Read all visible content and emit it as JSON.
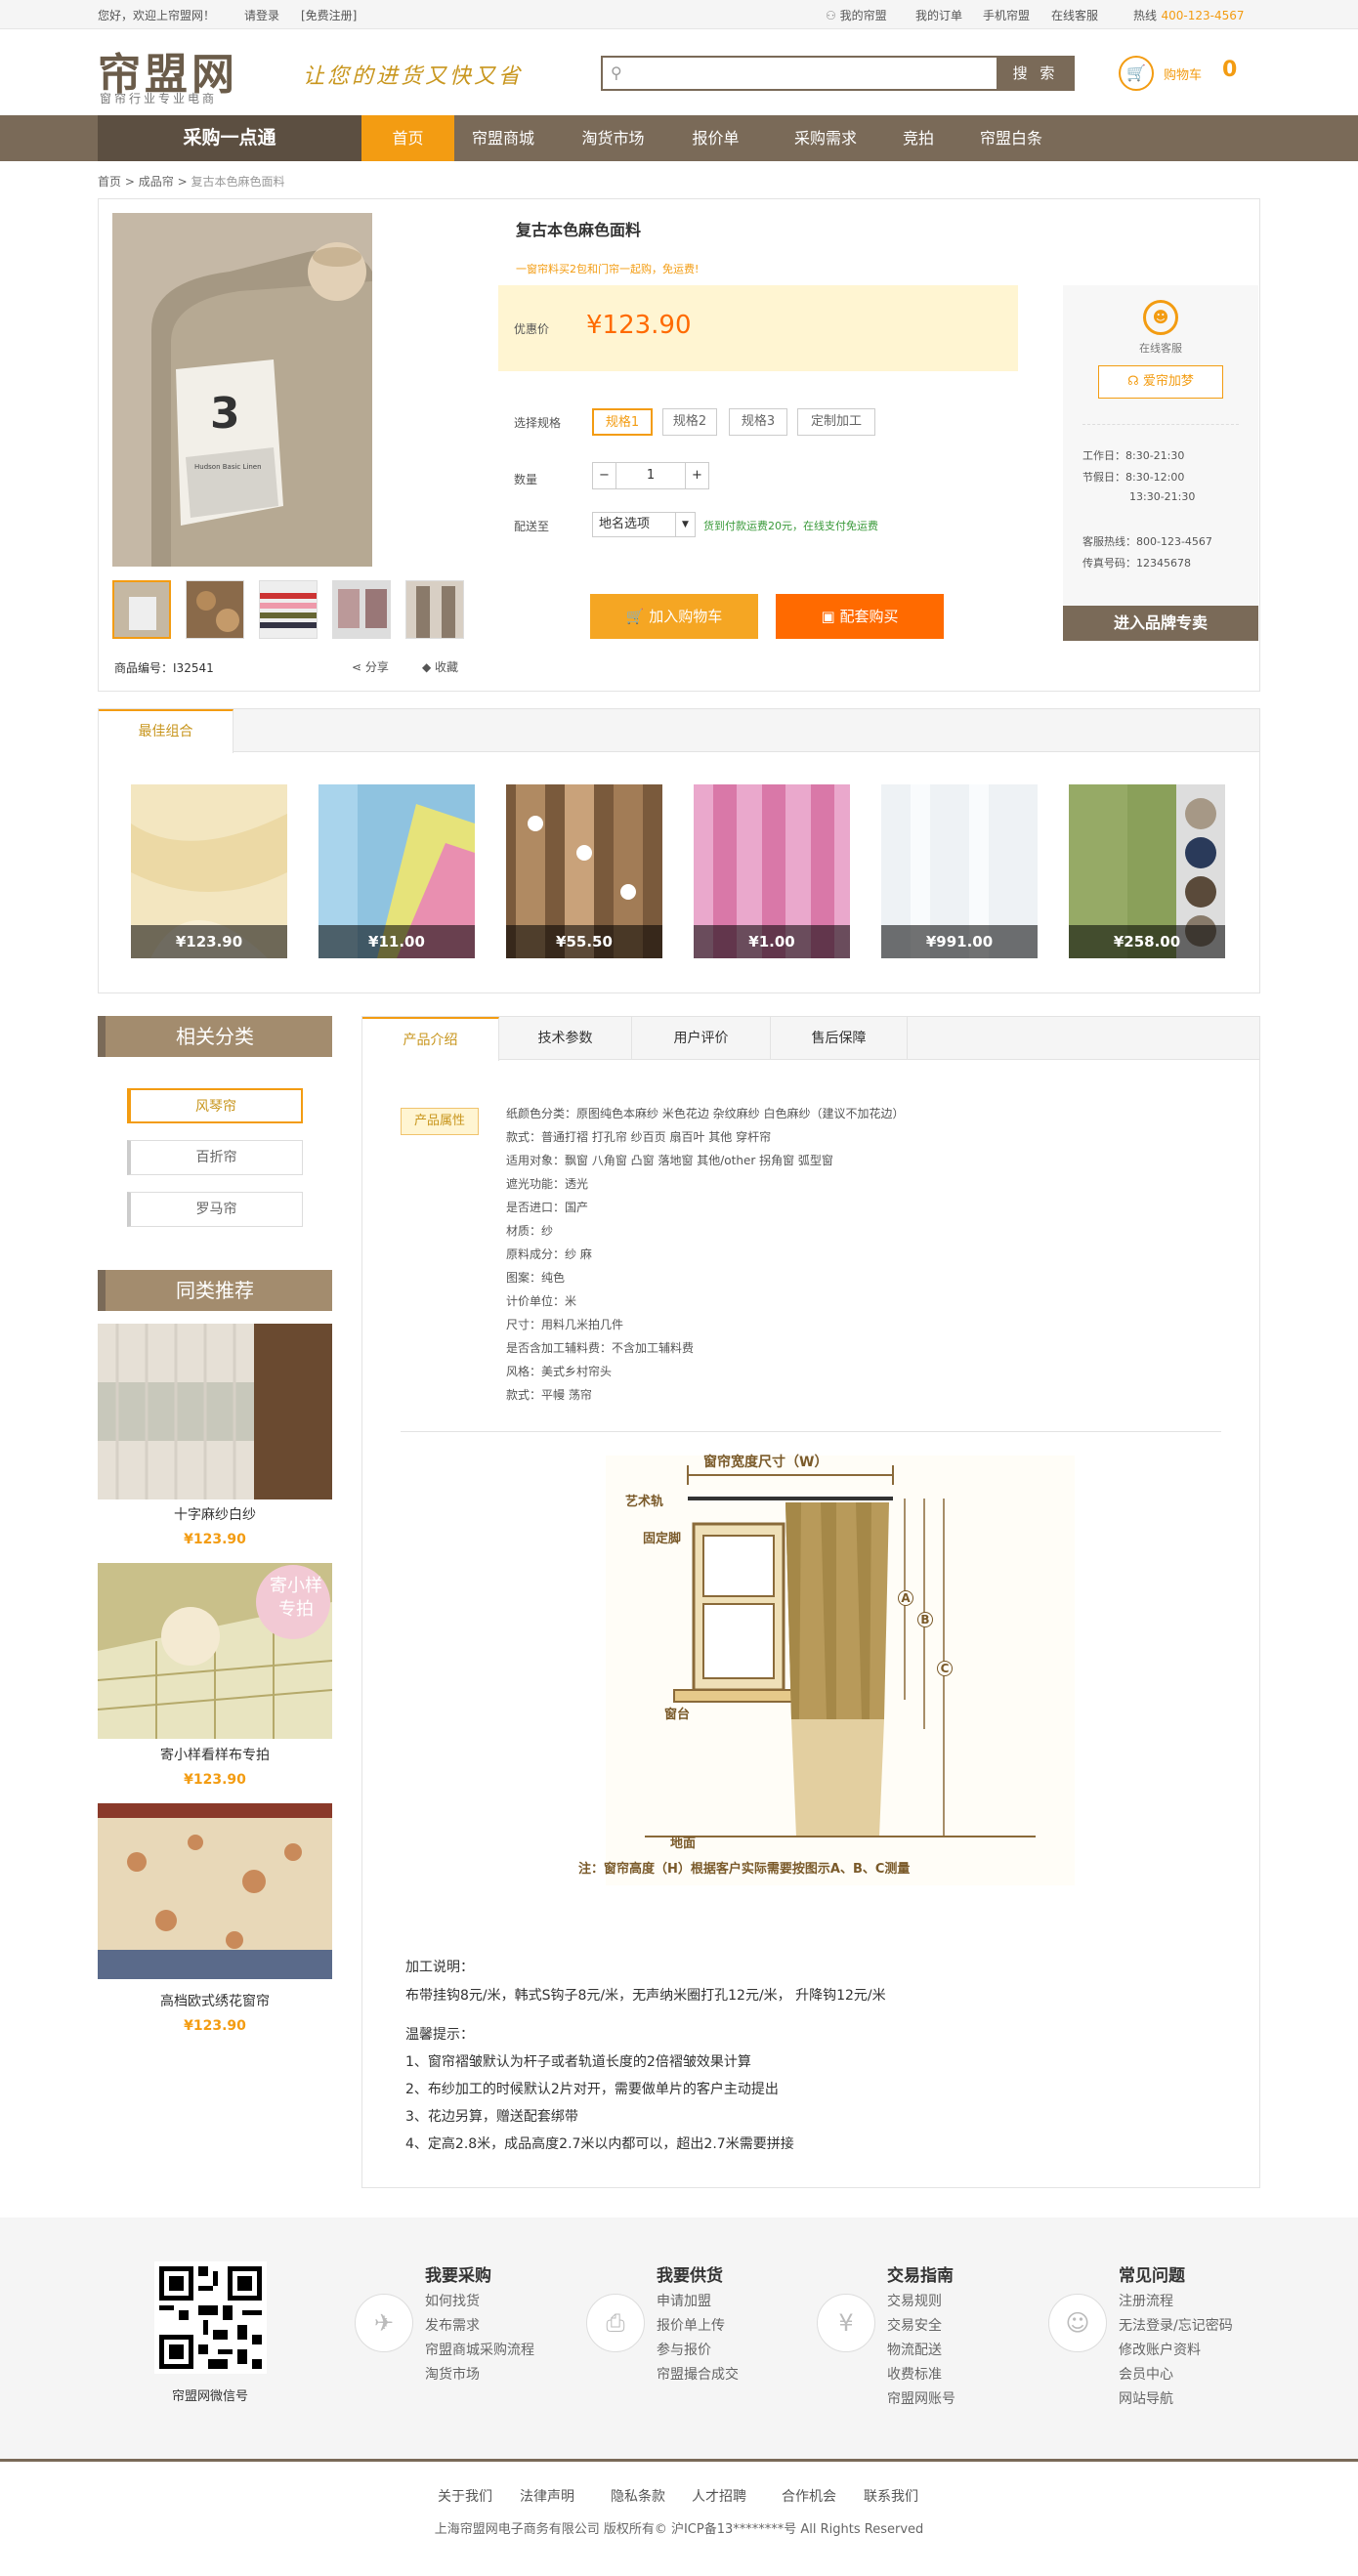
{
  "topbar": {
    "welcome": "您好，欢迎上帘盟网！",
    "login": "请登录",
    "register": "[免费注册]",
    "my_account": "我的帘盟",
    "my_orders": "我的订单",
    "mobile": "手机帘盟",
    "online_service": "在线客服",
    "hotline_label": "热线",
    "hotline": "400-123-4567"
  },
  "header": {
    "logo": "帘盟网",
    "logo_sub": "窗帘行业专业电商",
    "slogan": "让您的进货又快又省",
    "search_placeholder": "",
    "search_btn": "搜 索",
    "cart_label": "购物车",
    "cart_count": "0"
  },
  "nav": {
    "category": "采购一点通",
    "items": [
      "首页",
      "帘盟商城",
      "淘货市场",
      "报价单",
      "采购需求",
      "竞拍",
      "帘盟白条"
    ]
  },
  "breadcrumb": {
    "home": "首页",
    "sep": ">",
    "cat": "成品帘",
    "current": "复古本色麻色面料"
  },
  "product": {
    "title": "复古本色麻色面料",
    "promo": "一窗帘料买2包和门帘一起购，免运费!",
    "price_label": "优惠价",
    "price": "¥123.90",
    "spec_label": "选择规格",
    "specs": [
      "规格1",
      "规格2",
      "规格3",
      "定制加工"
    ],
    "qty_label": "数量",
    "qty": "1",
    "qty_minus": "−",
    "qty_plus": "+",
    "ship_label": "配送至",
    "ship_select": "地名选项",
    "ship_note": "货到付款运费20元，在线支付免运费",
    "add_cart": "加入购物车",
    "bundle_buy": "配套购买",
    "sku_label": "商品编号：",
    "sku": "I32541",
    "share": "分享",
    "favorite": "收藏",
    "image_label": "3",
    "image_tag": "Hudson Basic Linen"
  },
  "service": {
    "online": "在线客服",
    "brand": "爱帘加梦",
    "workday": "工作日：8:30-21:30",
    "holiday1": "节假日：8:30-12:00",
    "holiday2": "13:30-21:30",
    "hotline": "客服热线：800-123-4567",
    "fax": "传真号码：12345678",
    "brand_btn": "进入品牌专卖"
  },
  "combo": {
    "title": "最佳组合",
    "prices": [
      "¥123.90",
      "¥11.00",
      "¥55.50",
      "¥1.00",
      "¥991.00",
      "¥258.00"
    ]
  },
  "sidebar": {
    "cat_title": "相关分类",
    "cats": [
      "风琴帘",
      "百折帘",
      "罗马帘"
    ],
    "rec_title": "同类推荐",
    "recs": [
      {
        "name": "十字麻纱白纱",
        "price": "¥123.90"
      },
      {
        "name": "寄小样看样布专拍",
        "price": "¥123.90"
      },
      {
        "name": "高档欧式绣花窗帘",
        "price": "¥123.90"
      }
    ],
    "sample_badge_1": "寄小样",
    "sample_badge_2": "专拍"
  },
  "detail": {
    "tabs": [
      "产品介绍",
      "技术参数",
      "用户评价",
      "售后保障"
    ],
    "attr_tag": "产品属性",
    "attrs": [
      "纸颜色分类：原图纯色本麻纱 米色花边 杂纹麻纱 白色麻纱（建议不加花边）",
      "款式：普通打褶 打孔帘 纱百页 扇百叶 其他 穿杆帘",
      "适用对象：飘窗 八角窗 凸窗 落地窗 其他/other 拐角窗 弧型窗",
      "遮光功能：透光",
      "是否进口：国产",
      "材质：纱",
      "原料成分：纱 麻",
      "图案：纯色",
      "计价单位：米",
      "尺寸：用料几米拍几件",
      "是否含加工辅料费：不含加工辅料费",
      "风格：美式乡村帘头",
      "款式：平幔 荡帘"
    ],
    "diagram": {
      "width_label": "窗帘宽度尺寸（W）",
      "rod": "艺术轨",
      "bracket": "固定脚",
      "sill": "窗台",
      "floor": "地面",
      "a": "A",
      "b": "B",
      "c": "C",
      "note": "注：窗帘高度（H）根据客户实际需要按图示A、B、C测量"
    },
    "processing_title": "加工说明：",
    "processing_text": "布带挂钩8元/米，韩式S钩子8元/米，无声纳米圈打孔12元/米， 升降钩12元/米",
    "tips_title": "温馨提示：",
    "tips": [
      "1、窗帘褶皱默认为杆子或者轨道长度的2倍褶皱效果计算",
      "2、布纱加工的时候默认2片对开，需要做单片的客户主动提出",
      "3、花边另算，赠送配套绑带",
      "4、定高2.8米，成品高度2.7米以内都可以，超出2.7米需要拼接"
    ]
  },
  "footer": {
    "qr_label": "帘盟网微信号",
    "cols": [
      {
        "title": "我要采购",
        "links": [
          "如何找货",
          "发布需求",
          "帘盟商城采购流程",
          "淘货市场"
        ]
      },
      {
        "title": "我要供货",
        "links": [
          "申请加盟",
          "报价单上传",
          "参与报价",
          "帘盟撮合成交"
        ]
      },
      {
        "title": "交易指南",
        "links": [
          "交易规则",
          "交易安全",
          "物流配送",
          "收费标准",
          "帘盟网账号"
        ]
      },
      {
        "title": "常见问题",
        "links": [
          "注册流程",
          "无法登录/忘记密码",
          "修改账户资料",
          "会员中心",
          "网站导航"
        ]
      }
    ],
    "links": [
      "关于我们",
      "法律声明",
      "隐私条款",
      "人才招聘",
      "合作机会",
      "联系我们"
    ],
    "copyright": "上海帘盟网电子商务有限公司 版权所有©  沪ICP备13********号 All Rights Reserved"
  },
  "colors": {
    "brand": "#7a6a58",
    "accent": "#f39c12",
    "promo": "#ff6a00"
  }
}
